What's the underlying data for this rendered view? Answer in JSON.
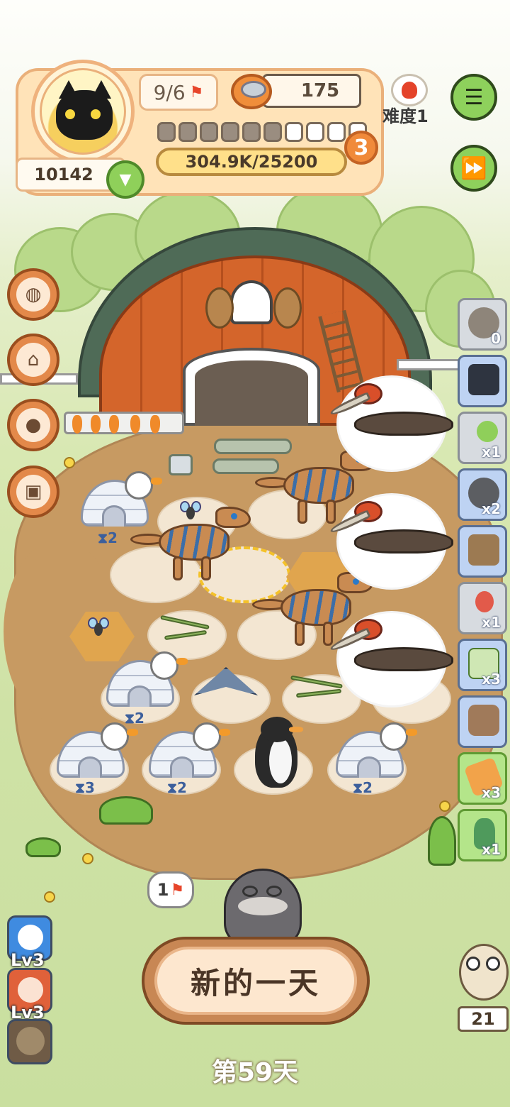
{
  "player": {
    "flags": "9/6",
    "coins": "175",
    "score": "10142",
    "xp": "304.9K/25200",
    "level": "3",
    "progress_filled": 6,
    "progress_total": 10
  },
  "difficulty": {
    "label": "难度1"
  },
  "menu": {
    "menu_icon": "hamburger-menu-icon",
    "fast_forward_icon": "fast-forward-icon"
  },
  "board": {
    "igloo_timers": [
      "2",
      "2",
      "3",
      "2",
      "2"
    ]
  },
  "inventory": [
    {
      "icon": "film-reel-icon",
      "count": "0"
    },
    {
      "icon": "camera-icon",
      "count": ""
    },
    {
      "icon": "fly-swatter-icon",
      "count": "x1"
    },
    {
      "icon": "pot-icon",
      "count": "x2"
    },
    {
      "icon": "rock-shelf-icon",
      "count": ""
    },
    {
      "icon": "fishing-float-icon",
      "count": "x1"
    },
    {
      "icon": "seed-card-icon",
      "count": "x3"
    },
    {
      "icon": "rock-bag-icon",
      "count": ""
    },
    {
      "icon": "bread-pack-icon",
      "count": "x3"
    },
    {
      "icon": "potion-bottle-icon",
      "count": "x1"
    }
  ],
  "speech": {
    "text": "1"
  },
  "new_day": {
    "label": "新的一天"
  },
  "day": {
    "label": "第59天"
  },
  "skills": [
    {
      "level": "Lv3"
    },
    {
      "level": "Lv3"
    }
  ],
  "owl": {
    "count": "21"
  },
  "colors": {
    "accent": "#8ed15c",
    "panel": "#ffe3b8",
    "field": "#c79a62"
  }
}
